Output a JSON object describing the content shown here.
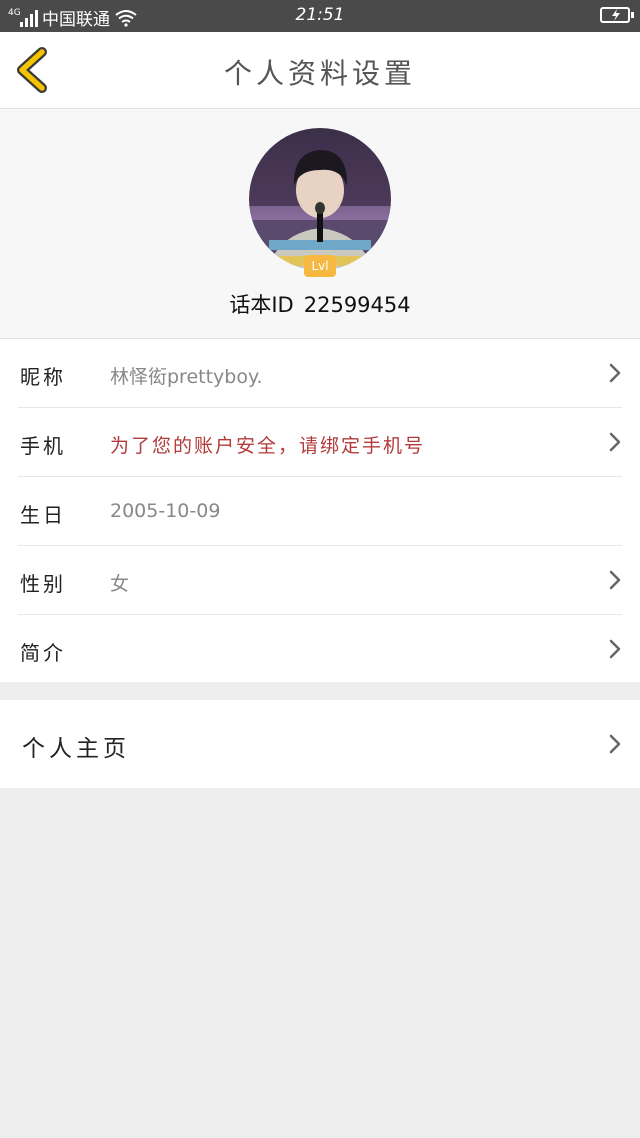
{
  "status_bar": {
    "network": "4G",
    "carrier": "中国联通",
    "time": "21:51"
  },
  "nav": {
    "title": "个人资料设置",
    "back_icon": "chevron-left-icon",
    "accent_color": "#f5c400"
  },
  "profile": {
    "level_badge": "Lvl",
    "id_label": "话本ID",
    "id_value": "22599454"
  },
  "settings": {
    "rows": [
      {
        "label": "昵称",
        "value": "林怿衒prettyboy.",
        "has_chevron": true
      },
      {
        "label": "手机",
        "value": "为了您的账户安全，请绑定手机号",
        "has_chevron": true,
        "value_color": "#b33a3a"
      },
      {
        "label": "生日",
        "value": "2005-10-09",
        "has_chevron": false
      },
      {
        "label": "性别",
        "value": "女",
        "has_chevron": true
      },
      {
        "label": "简介",
        "value": "",
        "has_chevron": true
      }
    ]
  },
  "homepage": {
    "label": "个人主页"
  }
}
